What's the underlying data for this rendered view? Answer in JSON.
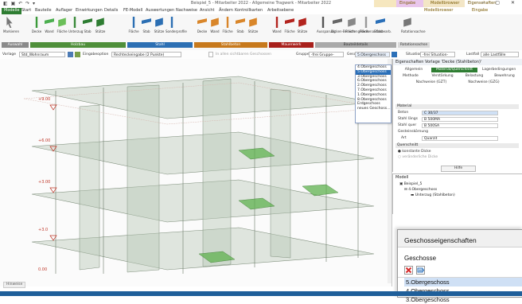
{
  "window": {
    "title": "Beispiel_5 - Mitarbeiter 2022 - Allgemeine Tragwerk - Mitarbeiter 2022",
    "context_tabs": [
      "Eingabe",
      "Modellbrowser",
      "Eigenschaften"
    ]
  },
  "tabs": [
    "Modelle",
    "Start",
    "Bauteile",
    "Auflager",
    "Einwirkungen",
    "Details",
    "FE-Modell",
    "Auswertungen",
    "Nachweise",
    "Ansicht",
    "Ändern",
    "Kontrollkarten",
    "Arbeitsebene",
    "Modellbrowser",
    "Eingabe"
  ],
  "active_tab": "Modelle",
  "ribbon": {
    "buttons": [
      {
        "label": "Markieren",
        "icon": "cursor-icon"
      },
      {
        "label": "Decke",
        "icon": "slab-icon"
      },
      {
        "label": "Wand",
        "icon": "wall-icon"
      },
      {
        "label": "Fläche",
        "icon": "area-icon"
      },
      {
        "label": "Unterzug",
        "icon": "beam-icon"
      },
      {
        "label": "Stab",
        "icon": "bar-icon"
      },
      {
        "label": "Stütze",
        "icon": "column-icon"
      },
      {
        "label": "Fläche",
        "icon": "area-icon"
      },
      {
        "label": "Stab",
        "icon": "bar-icon"
      },
      {
        "label": "Stütze",
        "icon": "column-icon"
      },
      {
        "label": "Sonderprofile",
        "icon": "profile-icon"
      },
      {
        "label": "Decke",
        "icon": "slab-icon"
      },
      {
        "label": "Wand",
        "icon": "wall-icon"
      },
      {
        "label": "Fläche",
        "icon": "area-icon"
      },
      {
        "label": "Stab",
        "icon": "bar-icon"
      },
      {
        "label": "Stütze",
        "icon": "column-icon"
      },
      {
        "label": "Wand",
        "icon": "wall-icon"
      },
      {
        "label": "Fläche",
        "icon": "area-icon"
      },
      {
        "label": "Stütze",
        "icon": "column-icon"
      },
      {
        "label": "Aussparung",
        "icon": "opening-icon"
      },
      {
        "label": "Dicken-Bereich",
        "icon": "thickness-icon"
      },
      {
        "label": "Flächengelenk",
        "icon": "hinge-icon"
      },
      {
        "label": "Flächenauflast",
        "icon": "load-icon"
      },
      {
        "label": "Stabbearb.",
        "icon": "bar-edit-icon"
      },
      {
        "label": "Rotationsachse",
        "icon": "axis-icon"
      }
    ],
    "groups": [
      "Auswahl",
      "Holzbau",
      "Stahl",
      "Stahlbeton",
      "Mauerwerk",
      "Bauteildetails",
      "Rotationsachse"
    ]
  },
  "toolbar": {
    "vorlage_label": "Vorlage",
    "vorlage_value": "Std_Wohnraum",
    "eingabe_label": "Eingabeoption",
    "eingabe_value": "Rechteckeingabe (2 Punkte)",
    "checkbox_label": "In allen sichtbaren Geschossen",
    "gruppe_label": "Gruppe",
    "gruppe_value": "-frei Gruppe-",
    "geschoss_label": "Geschoss",
    "geschoss_value": "5.Obergeschoss",
    "situation_label": "Situation",
    "situation_value": "-frei Situation-",
    "lastfall_label": "Lastfall",
    "lastfall_value": "alle Lastfälle"
  },
  "storey_dropdown": [
    "4.Obergeschoss",
    "5.Obergeschoss",
    "3.Obergeschoss",
    "6.Obergeschoss",
    "2.Obergeschoss",
    "7.Obergeschoss",
    "1.Obergeschoss",
    "8.Obergeschoss",
    "Erdgeschoss",
    "neues Geschoss..."
  ],
  "storey_selected": 1,
  "viewport": {
    "levels": [
      "+9.00",
      "+6.00",
      "+3.00",
      "+3.0",
      "0.00"
    ],
    "tab": "Hinweise"
  },
  "properties": {
    "header": "Eigenschaften Vorlage 'Decke (Stahlbeton)'",
    "tabs_row1": [
      "Allgemein",
      "Material/Querschnitt",
      "Lagerbedingungen"
    ],
    "tabs_row2": [
      "Methode",
      "Verstärkung",
      "Belastung",
      "Bewehrung"
    ],
    "tabs_row3": [
      "Nachweise (GZT)",
      "Nachweise (GZG)"
    ],
    "section_material": "Material",
    "rows": [
      {
        "label": "Beton",
        "value": "C 30/37"
      },
      {
        "label": "Stahl längs",
        "value": "B 500MA"
      },
      {
        "label": "Stahl quer",
        "value": "B 500SA"
      },
      {
        "label": "Gesteinskörnung",
        "value": ""
      },
      {
        "label": "Art",
        "value": "Quarzit"
      }
    ],
    "section_querschnitt": "Querschnitt",
    "radio1": "konstante Dicke",
    "radio2": "veränderliche Dicke",
    "help_btn": "Hilfe"
  },
  "model_tree": {
    "header": "Modell",
    "items": [
      "Beispiel_5",
      "4.Obergeschoss",
      "Unterzug (Stahlbeton)"
    ]
  },
  "callout": {
    "title": "Geschosseigenschaften",
    "subtitle": "Geschosse",
    "rows": [
      "5.Obergeschoss",
      "4.Obergeschoss",
      "3.Obergeschoss"
    ],
    "selected": 0
  }
}
